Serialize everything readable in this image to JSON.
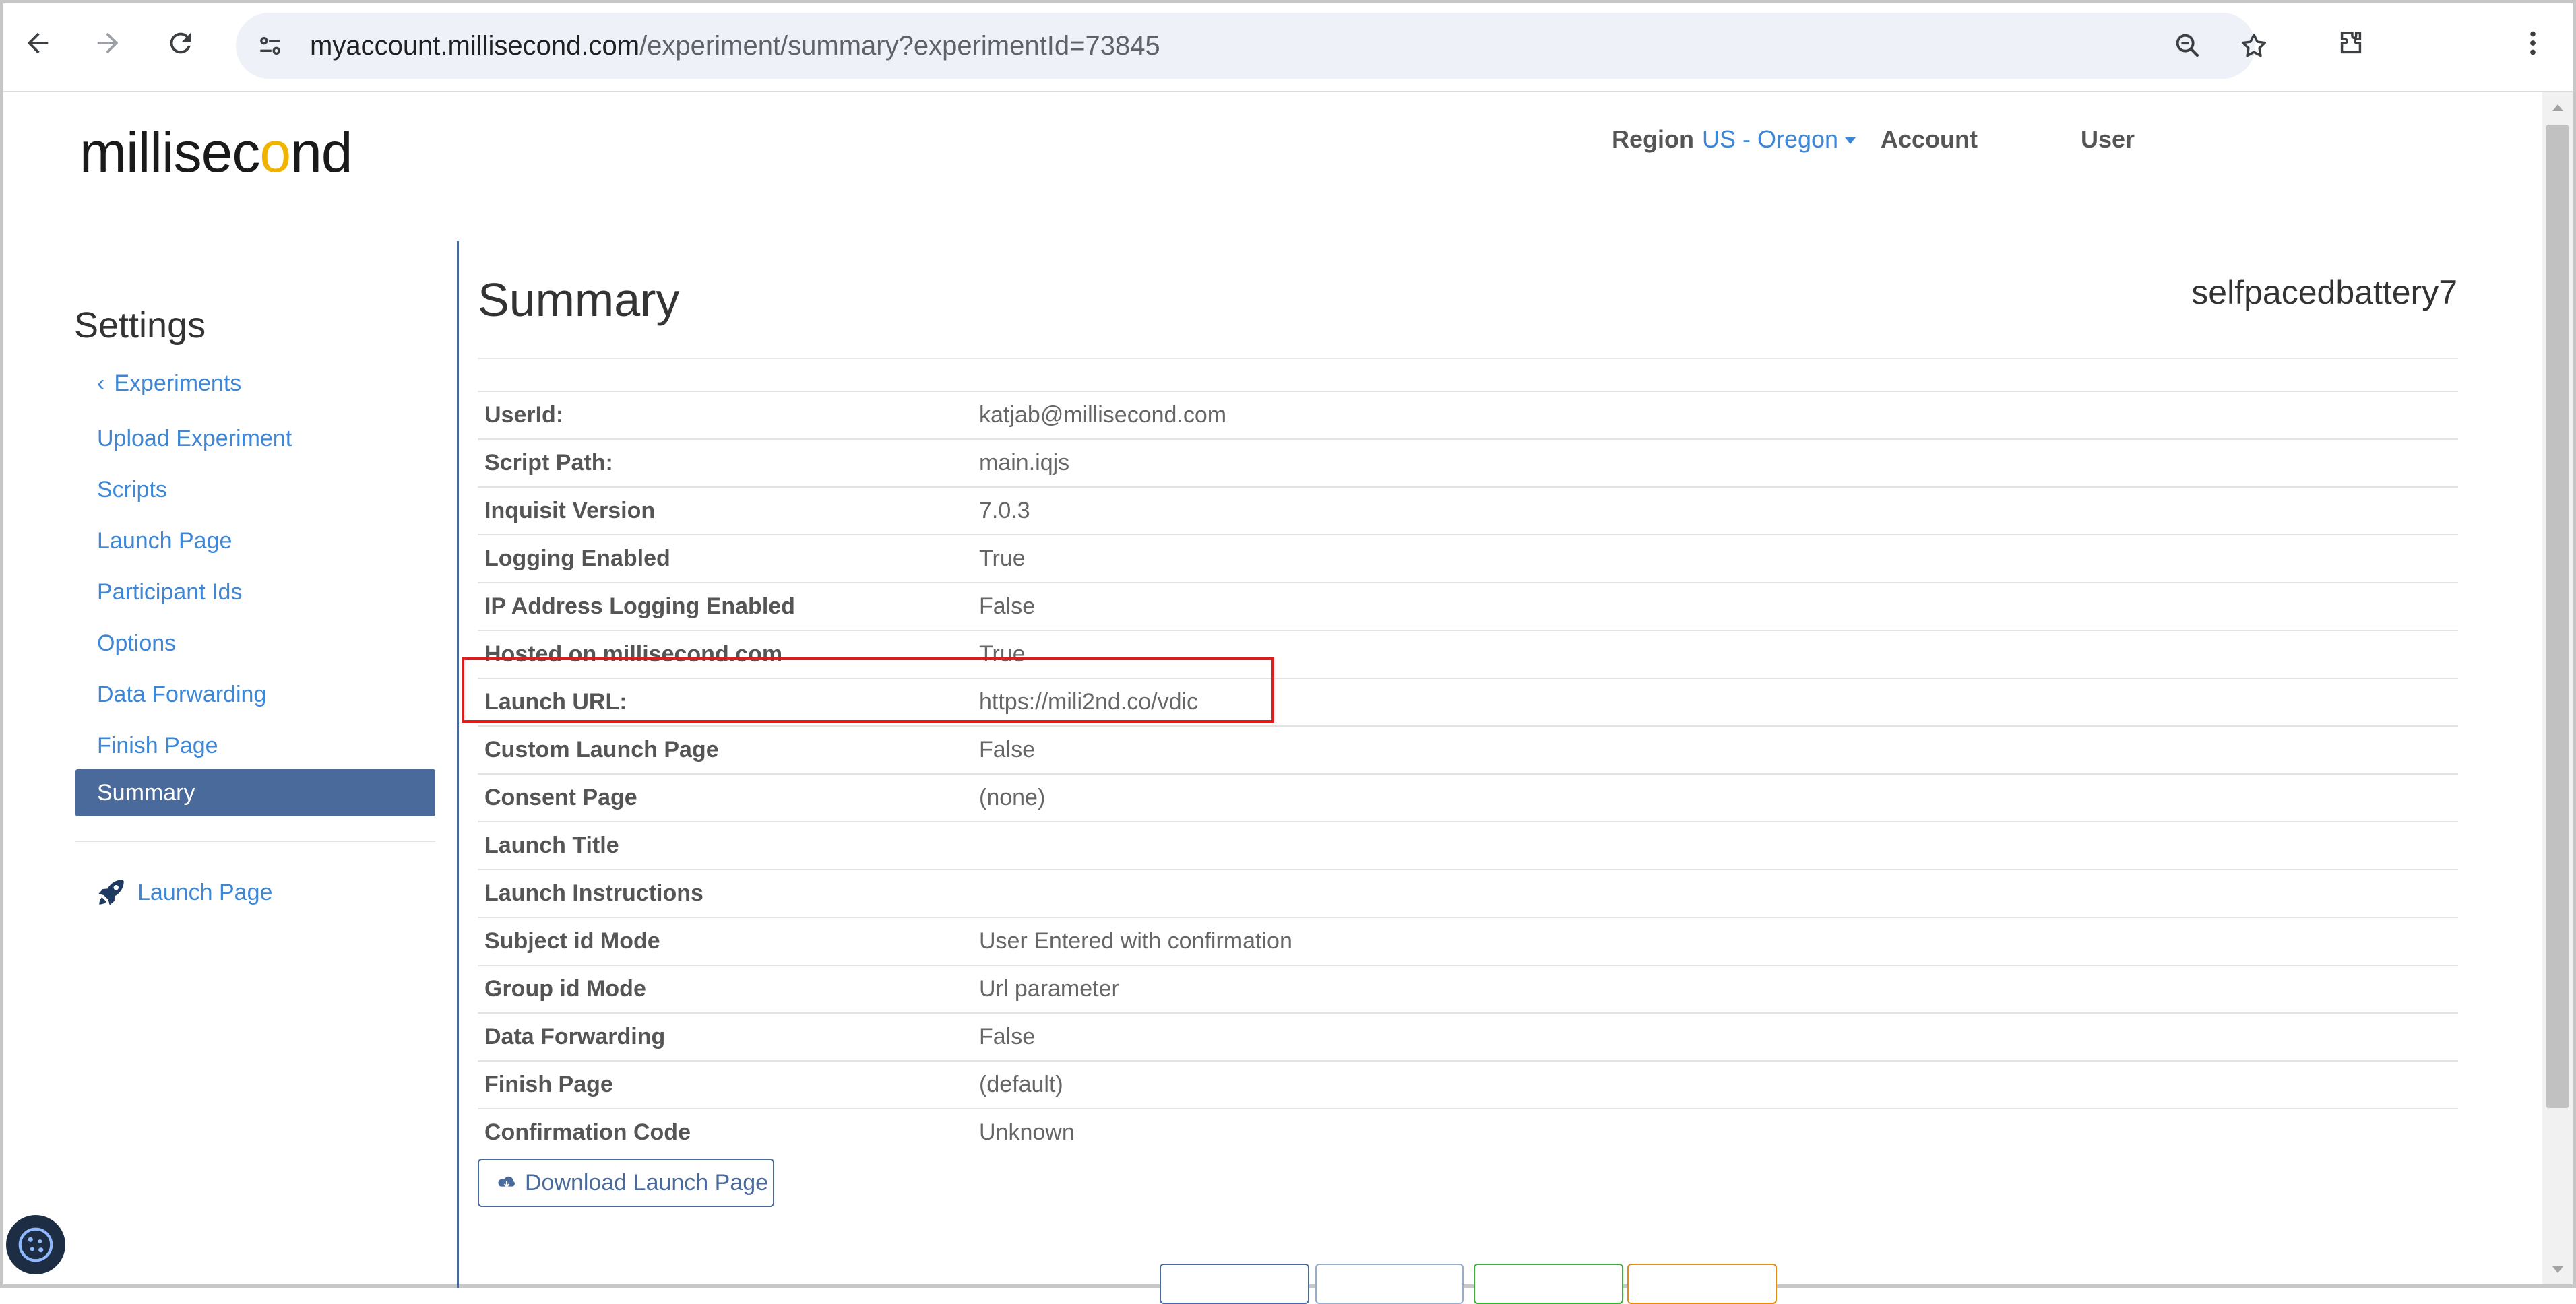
{
  "browser": {
    "url_host": "myaccount.millisecond.com",
    "url_path": "/experiment/summary?experimentId=73845",
    "icons": [
      "back-arrow-icon",
      "forward-arrow-icon",
      "reload-icon",
      "site-info-icon",
      "zoom-out-icon",
      "bookmark-star-icon",
      "extensions-icon",
      "kebab-menu-icon"
    ]
  },
  "header": {
    "logo_text_a": "millise",
    "logo_text_b": "c",
    "logo_text_c": "o",
    "logo_text_d": "nd",
    "region_label": "Region",
    "region_value": "US - Oregon",
    "account_label": "Account",
    "user_label": "User"
  },
  "sidebar": {
    "title": "Settings",
    "back_label": "Experiments",
    "items": [
      {
        "label": "Upload Experiment"
      },
      {
        "label": "Scripts"
      },
      {
        "label": "Launch Page"
      },
      {
        "label": "Participant Ids"
      },
      {
        "label": "Options"
      },
      {
        "label": "Data Forwarding"
      },
      {
        "label": "Finish Page"
      }
    ],
    "active_label": "Summary",
    "launch_link": "Launch Page"
  },
  "main": {
    "title": "Summary",
    "experiment_name": "selfpacedbattery7",
    "rows": [
      {
        "key": "UserId:",
        "value": "katjab@millisecond.com"
      },
      {
        "key": "Script Path:",
        "value": "main.iqjs"
      },
      {
        "key": "Inquisit Version",
        "value": "7.0.3"
      },
      {
        "key": "Logging Enabled",
        "value": "True"
      },
      {
        "key": "IP Address Logging Enabled",
        "value": "False"
      },
      {
        "key": "Hosted on millisecond.com",
        "value": "True"
      },
      {
        "key": "Launch URL:",
        "value": "https://mili2nd.co/vdic"
      },
      {
        "key": "Custom Launch Page",
        "value": "False"
      },
      {
        "key": "Consent Page",
        "value": "(none)"
      },
      {
        "key": "Launch Title",
        "value": ""
      },
      {
        "key": "Launch Instructions",
        "value": ""
      },
      {
        "key": "Subject id Mode",
        "value": "User Entered with confirmation"
      },
      {
        "key": "Group id Mode",
        "value": "Url parameter"
      },
      {
        "key": "Data Forwarding",
        "value": "False"
      },
      {
        "key": "Finish Page",
        "value": "(default)"
      },
      {
        "key": "Confirmation Code",
        "value": "Unknown"
      }
    ],
    "download_label": "Download Launch Page"
  },
  "colors": {
    "accent": "#4a6a9b",
    "link": "#3d87d6",
    "highlight": "#e01b1b",
    "logo_ring": "#f0b400"
  }
}
